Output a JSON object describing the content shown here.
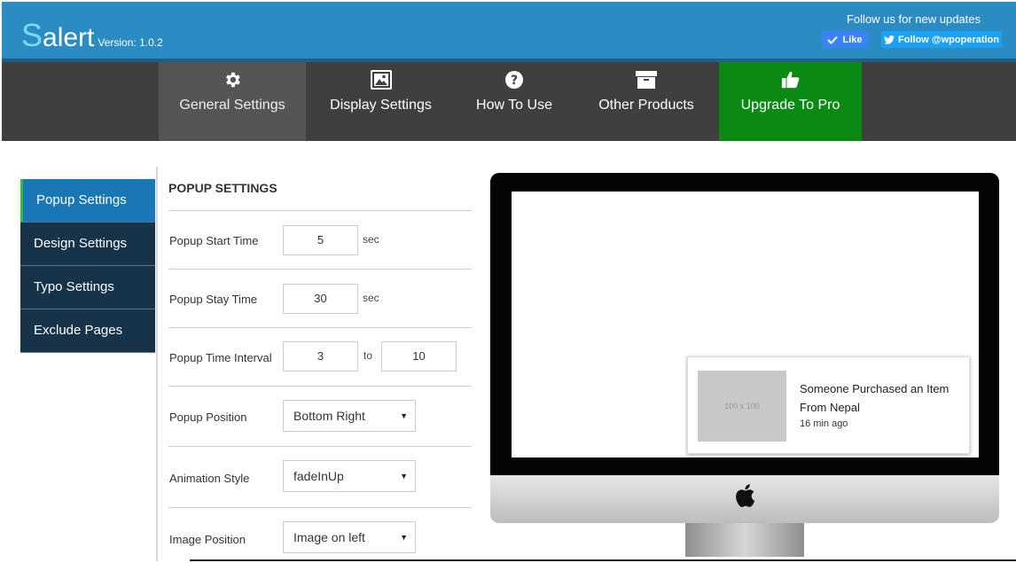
{
  "header": {
    "logo_first": "S",
    "logo_rest": "alert",
    "version": "Version: 1.0.2",
    "follow_text": "Follow us for new updates",
    "like_label": "Like",
    "twitter_label": "Follow @wpoperation",
    "bg_color": "#2b8cc4"
  },
  "nav": {
    "tabs": [
      {
        "label": "General Settings",
        "icon": "gear-icon"
      },
      {
        "label": "Display Settings",
        "icon": "image-icon"
      },
      {
        "label": "How To Use",
        "icon": "question-icon"
      },
      {
        "label": "Other Products",
        "icon": "archive-icon"
      },
      {
        "label": "Upgrade To Pro",
        "icon": "thumbs-up-icon"
      }
    ],
    "active": "General Settings",
    "upgrade_color": "#0a8a12"
  },
  "sidebar": {
    "items": [
      {
        "label": "Popup Settings"
      },
      {
        "label": "Design Settings"
      },
      {
        "label": "Typo Settings"
      },
      {
        "label": "Exclude Pages"
      }
    ],
    "active": "Popup Settings"
  },
  "form": {
    "title": "POPUP SETTINGS",
    "start_time": {
      "label": "Popup Start Time",
      "value": "5",
      "unit": "sec"
    },
    "stay_time": {
      "label": "Popup Stay Time",
      "value": "30",
      "unit": "sec"
    },
    "interval": {
      "label": "Popup Time Interval",
      "from": "3",
      "to_label": "to",
      "to": "10"
    },
    "position": {
      "label": "Popup Position",
      "value": "Bottom Right"
    },
    "animation": {
      "label": "Animation Style",
      "value": "fadeInUp"
    },
    "image_position": {
      "label": "Image Position",
      "value": "Image on left"
    }
  },
  "preview": {
    "thumb_text": "100 x 100",
    "line1": "Someone Purchased an Item From Nepal",
    "time": "16 min ago"
  }
}
